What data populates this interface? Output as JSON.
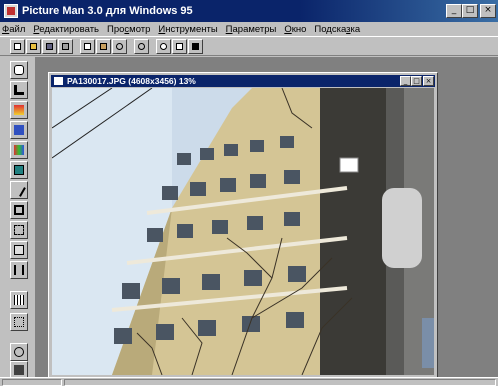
{
  "window": {
    "title": "Picture Man 3.0 для Windows 95",
    "controls": [
      "_",
      "□",
      "×"
    ]
  },
  "menu": [
    {
      "underline": "Ф",
      "rest": "айл"
    },
    {
      "underline": "Р",
      "rest": "едактировать"
    },
    {
      "pre": "Про",
      "underline": "с",
      "rest": "мотр"
    },
    {
      "underline": "И",
      "rest": "нструменты"
    },
    {
      "underline": "П",
      "rest": "араметры"
    },
    {
      "underline": "О",
      "rest": "кно"
    },
    {
      "pre": "Подска",
      "underline": "з",
      "rest": "ка"
    }
  ],
  "toolbar": {
    "icons": [
      "new-icon",
      "open-icon",
      "save-icon",
      "print-icon",
      "copy-icon",
      "paste-icon",
      "undo-icon",
      "redo-icon",
      "zoom-icon",
      "actual-size-icon",
      "fit-window-icon"
    ]
  },
  "toolbox": {
    "icons": [
      "eraser-icon",
      "brush-icon",
      "color-fill-icon",
      "pencil-icon",
      "palette-icon",
      "monitor-icon",
      "magic-wand-icon",
      "crop-icon",
      "transform-icon",
      "resize-icon",
      "flip-icon",
      "grid-icon",
      "selection-icon",
      "rotate-icon",
      "swatch-icon"
    ]
  },
  "document": {
    "title": "PA130017.JPG (4608x3456) 13%",
    "controls": [
      "_",
      "□",
      "×"
    ]
  }
}
